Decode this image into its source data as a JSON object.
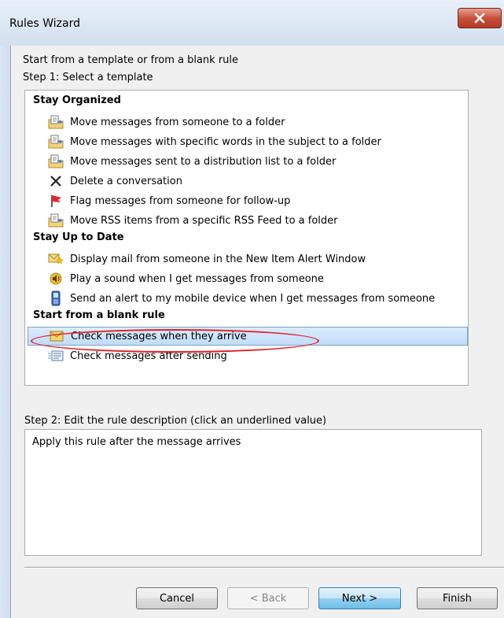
{
  "window": {
    "title": "Rules Wizard"
  },
  "intro": {
    "line1": "Start from a template or from a blank rule",
    "step1": "Step 1: Select a template"
  },
  "groups": [
    {
      "label": "Stay Organized",
      "items": [
        {
          "label": "Move messages from someone to a folder",
          "icon": "move-to-folder-icon"
        },
        {
          "label": "Move messages with specific words in the subject to a folder",
          "icon": "move-to-folder-icon"
        },
        {
          "label": "Move messages sent to a distribution list to a folder",
          "icon": "move-to-folder-icon"
        },
        {
          "label": "Delete a conversation",
          "icon": "delete-x-icon"
        },
        {
          "label": "Flag messages from someone for follow-up",
          "icon": "flag-icon"
        },
        {
          "label": "Move RSS items from a specific RSS Feed to a folder",
          "icon": "move-to-folder-icon"
        }
      ]
    },
    {
      "label": "Stay Up to Date",
      "items": [
        {
          "label": "Display mail from someone in the New Item Alert Window",
          "icon": "alert-window-icon"
        },
        {
          "label": "Play a sound when I get messages from someone",
          "icon": "sound-icon"
        },
        {
          "label": "Send an alert to my mobile device when I get messages from someone",
          "icon": "mobile-device-icon"
        }
      ]
    },
    {
      "label": "Start from a blank rule",
      "items": [
        {
          "label": "Check messages when they arrive",
          "icon": "envelope-icon",
          "selected": true
        },
        {
          "label": "Check messages after sending",
          "icon": "sent-message-icon"
        }
      ]
    }
  ],
  "step2": {
    "label": "Step 2: Edit the rule description (click an underlined value)",
    "description": "Apply this rule after the message arrives"
  },
  "buttons": {
    "cancel": "Cancel",
    "back": "< Back",
    "next": "Next >",
    "finish": "Finish"
  },
  "colors": {
    "selection": "#c1dcfa",
    "highlight_oval": "#e0202a"
  }
}
